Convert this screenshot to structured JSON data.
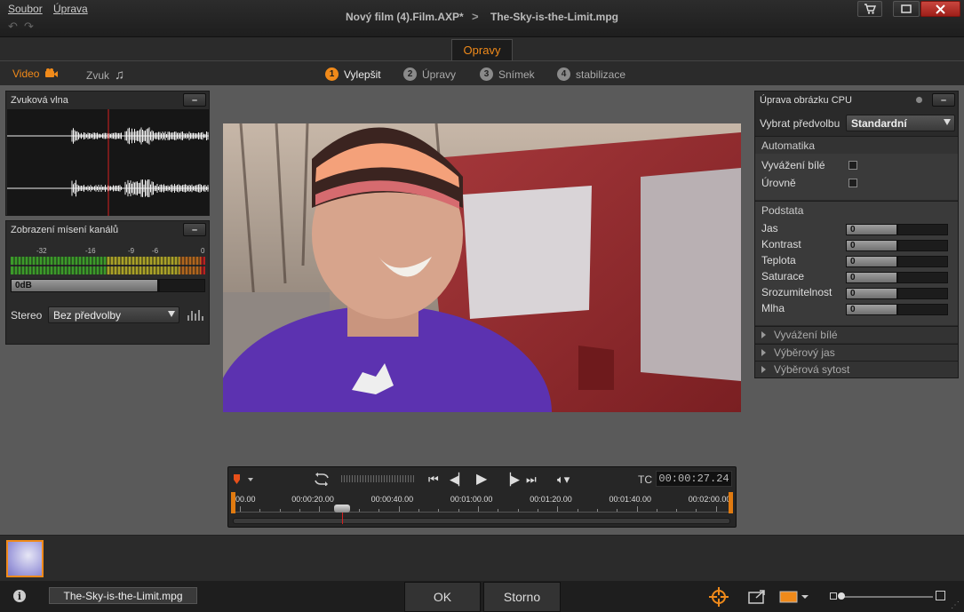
{
  "menu": {
    "file": "Soubor",
    "edit": "Úprava"
  },
  "title": {
    "project": "Nový film (4).Film.AXP*",
    "separator": ">",
    "file": "The-Sky-is-the-Limit.mpg"
  },
  "edit_tab": "Opravy",
  "media_tabs": {
    "video": "Video",
    "audio": "Zvuk"
  },
  "steps": [
    {
      "num": "1",
      "label": "Vylepšit",
      "active": true
    },
    {
      "num": "2",
      "label": "Úpravy",
      "active": false
    },
    {
      "num": "3",
      "label": "Snímek",
      "active": false
    },
    {
      "num": "4",
      "label": "stabilizace",
      "active": false
    }
  ],
  "waveform_panel": {
    "title": "Zvuková vlna",
    "collapse": "–"
  },
  "mixer_panel": {
    "title": "Zobrazení mísení kanálů",
    "collapse": "–",
    "scale": [
      "-32",
      "-16",
      "-9",
      "-6",
      "0"
    ],
    "gain": "0dB",
    "stereo_label": "Stereo",
    "preset": "Bez předvolby"
  },
  "cpu_panel": {
    "title": "Úprava obrázku CPU",
    "collapse": "–",
    "preset_label": "Vybrat předvolbu",
    "preset_value": "Standardní",
    "auto": {
      "title": "Automatika",
      "white_balance": "Vyvážení bílé",
      "levels": "Úrovně"
    },
    "basic": {
      "title": "Podstata",
      "rows": [
        {
          "label": "Jas",
          "value": "0"
        },
        {
          "label": "Kontrast",
          "value": "0"
        },
        {
          "label": "Teplota",
          "value": "0"
        },
        {
          "label": "Saturace",
          "value": "0"
        },
        {
          "label": "Srozumitelnost",
          "value": "0"
        },
        {
          "label": "Mlha",
          "value": "0"
        }
      ]
    },
    "collapsed_sections": [
      "Vyvážení bílé",
      "Výběrový jas",
      "Výběrová sytost"
    ]
  },
  "transport": {
    "tc_label": "TC",
    "timecode": "00:00:27.24",
    "ruler": [
      "00.00",
      "00:00:20.00",
      "00:00:40.00",
      "00:01:00.00",
      "00:01:20.00",
      "00:01:40.00",
      "00:02:00.00"
    ],
    "playhead_fraction": 0.22
  },
  "bottom": {
    "info": "i",
    "file": "The-Sky-is-the-Limit.mpg",
    "ok": "OK",
    "cancel": "Storno"
  },
  "colors": {
    "accent": "#f08a1a",
    "close": "#c0392b"
  }
}
